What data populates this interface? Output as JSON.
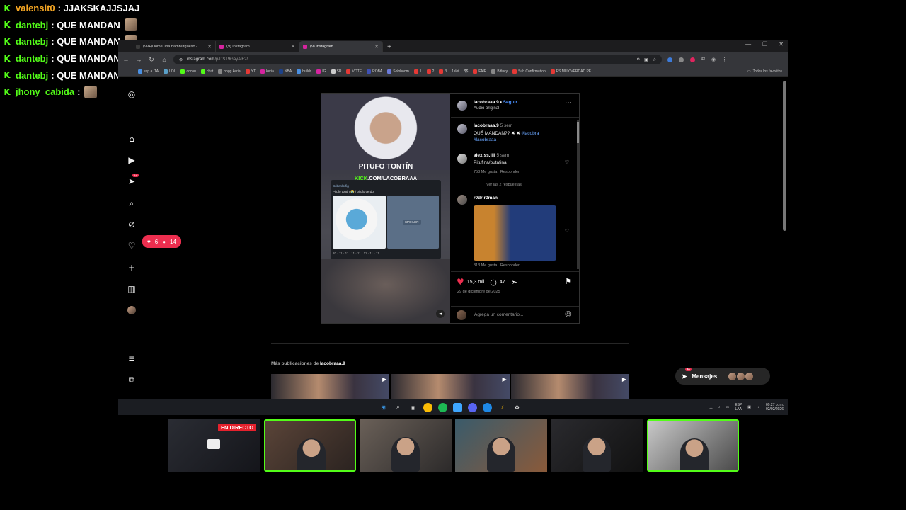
{
  "chat": {
    "lines": [
      {
        "user": "valensit0",
        "color": "#f5a623",
        "msg": "JJAKSKAJJSJAJ"
      },
      {
        "user": "dantebj",
        "color": "#53fc18",
        "msg": "QUE MANDAN"
      },
      {
        "user": "dantebj",
        "color": "#53fc18",
        "msg": "QUE MANDAN"
      },
      {
        "user": "dantebj",
        "color": "#53fc18",
        "msg": "QUE MANDAN"
      },
      {
        "user": "dantebj",
        "color": "#53fc18",
        "msg": "QUE MANDAN"
      },
      {
        "user": "jhony_cabida",
        "color": "#53fc18",
        "msg": ""
      }
    ],
    "separator": ":"
  },
  "browser": {
    "tabs": [
      {
        "title": "(99+)Dome una hamburgueso -",
        "favicon_color": "#3b3b3b"
      },
      {
        "title": "(9) Instagram",
        "favicon_color": "#d6249f"
      },
      {
        "title": "(9) Instagram",
        "favicon_color": "#d6249f"
      }
    ],
    "url_host": "instagram.com",
    "url_path": "/p/DS19GayAlF2/",
    "bookmarks": [
      "esp a ITA",
      "LOL",
      "cocou",
      "chat",
      "opgg keria",
      "YT",
      "keria",
      "NBA",
      "builds",
      "IG",
      "SR",
      "VOTE",
      "ROBA",
      "Soloboom",
      "1",
      "2",
      "3",
      "1slot",
      "$$",
      "FAIR",
      "Bitlucy",
      "Sub Confirmation",
      "ES MUY VERDAD PE..."
    ],
    "all_favorites": "Todos los favoritos"
  },
  "instagram": {
    "notif": {
      "likes": "6",
      "followers": "14"
    },
    "post": {
      "username": "lacobraaa.9",
      "follow": "Seguir",
      "audio": "Audio original",
      "caption_user": "lacobraaa.9",
      "caption_time": "5 sem",
      "caption_text": "QUÉ MANDAN?? ✖ ✖",
      "caption_tag1": "#lacobra",
      "caption_tag2": "#lacobraaa",
      "media_title": "PITUFO TONTÍN",
      "media_kick_k": "KICK",
      "media_kick_rest": ".COM/LACOBRAAA",
      "card_head": "Bobenlorfig",
      "card_sub": "Pitufo tontin 😭 / pitufo cerdo",
      "card_spoiler": "SPOILER",
      "card_reactions": "20 · 11 · 11 · 11 · 11 · 11 · 11 · 11",
      "comments": [
        {
          "user": "alexiss.llll",
          "time": "5 sem",
          "text": "Pitufina/putafina",
          "likes": "758 Me gusta",
          "reply": "Responder",
          "view_replies": "Ver las 2 respuestas"
        },
        {
          "user": "r0drir0man",
          "time": "",
          "text": "",
          "likes": "313 Me gusta",
          "reply": "Responder"
        }
      ],
      "like_count": "15,3 mil",
      "comment_count": "47",
      "date": "29 de diciembre de 2025",
      "add_comment_placeholder": "Agrega un comentario..."
    },
    "more_posts_label": "Más publicaciones de",
    "more_posts_account": "lacobraaa.9",
    "messages_label": "Mensajes",
    "messages_badge": "9+",
    "nav_badge": "9+"
  },
  "taskbar": {
    "lang1": "ESP",
    "lang2": "LAA",
    "time": "09:27 p. m.",
    "date": "02/02/2026"
  },
  "webcams": {
    "live_label": "EN DIRECTO"
  }
}
